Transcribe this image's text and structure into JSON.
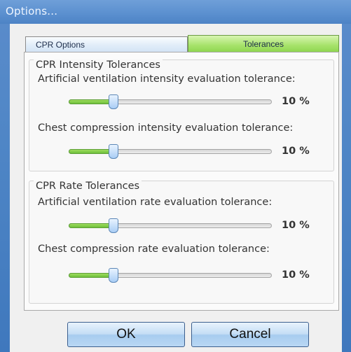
{
  "window": {
    "title": "Options..."
  },
  "tabs": [
    {
      "label": "CPR Options",
      "active": false
    },
    {
      "label": "Tolerances",
      "active": true
    }
  ],
  "groups": [
    {
      "title": "CPR Intensity Tolerances",
      "sliders": [
        {
          "label": "Artificial ventilation intensity evaluation tolerance:",
          "value_text": "10 %",
          "level": 0.22
        },
        {
          "label": "Chest compression intensity evaluation tolerance:",
          "value_text": "10 %",
          "level": 0.22
        }
      ]
    },
    {
      "title": "CPR Rate Tolerances",
      "sliders": [
        {
          "label": "Artificial ventilation rate evaluation tolerance:",
          "value_text": "10 %",
          "level": 0.22
        },
        {
          "label": "Chest compression rate evaluation tolerance:",
          "value_text": "10 %",
          "level": 0.22
        }
      ]
    }
  ],
  "buttons": {
    "ok": "OK",
    "cancel": "Cancel"
  },
  "colors": {
    "titlebar": "#5a8fcf",
    "active_tab": "#a7e36b",
    "slider_fill": "#7ccb45",
    "slider_thumb": "#a9cdf5",
    "button": "#b9d7f4"
  }
}
